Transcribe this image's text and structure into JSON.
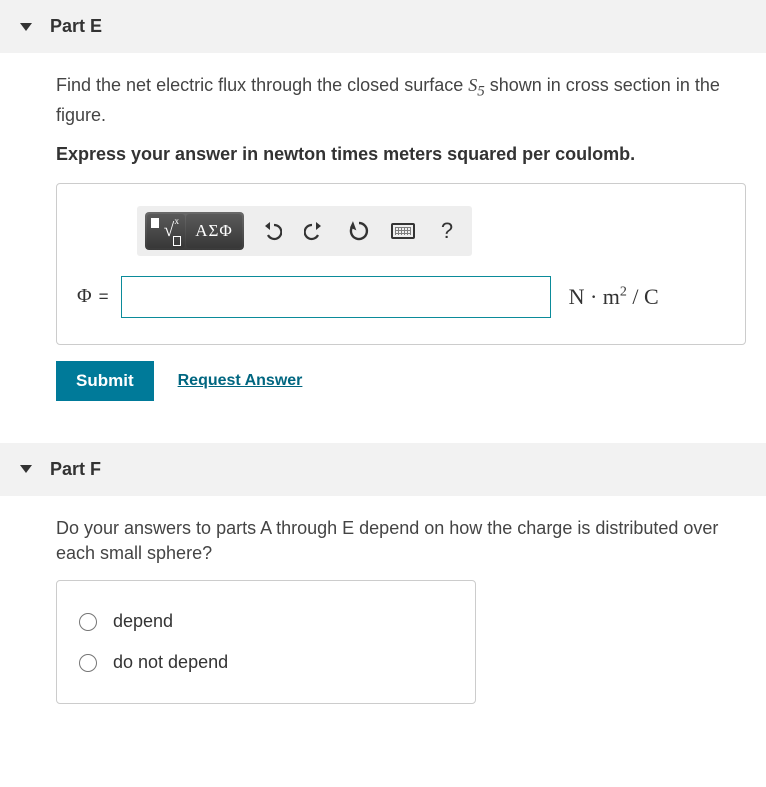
{
  "partE": {
    "title": "Part E",
    "question_prefix": "Find the net electric flux through the closed surface ",
    "question_var": "S",
    "question_sub": "5",
    "question_suffix": " shown in cross section in the figure.",
    "instruction": "Express your answer in newton times meters squared per coulomb.",
    "toolbar": {
      "templates": "√",
      "greek": "ΑΣΦ",
      "undo": "↶",
      "redo": "↷",
      "reset": "↻",
      "keyboard": "⌨",
      "help": "?"
    },
    "phi_label": "Φ",
    "equals": "=",
    "answer_value": "",
    "unit": "N · m² / C",
    "submit": "Submit",
    "request": "Request Answer"
  },
  "partF": {
    "title": "Part F",
    "question": "Do your answers to parts A through E depend on how the charge is distributed over each small sphere?",
    "options": [
      "depend",
      "do not depend"
    ]
  }
}
